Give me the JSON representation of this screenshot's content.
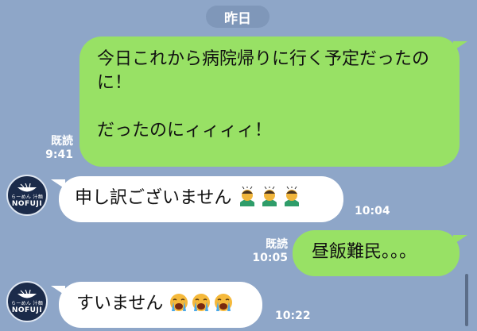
{
  "date_separator": "昨日",
  "messages": [
    {
      "side": "out",
      "text": "今日これから病院帰りに行く予定だったのに！\n\nだったのにィィィィ！",
      "read_label": "既読",
      "time": "9:41"
    },
    {
      "side": "in",
      "text": "申し訳ございません",
      "emoji": [
        "person-bowing",
        "person-bowing",
        "person-bowing"
      ],
      "time": "10:04"
    },
    {
      "side": "out",
      "text": "昼飯難民。。。",
      "read_label": "既読",
      "time": "10:05"
    },
    {
      "side": "in",
      "text": "すいません",
      "emoji": [
        "loudly-crying-face",
        "loudly-crying-face",
        "loudly-crying-face"
      ],
      "time": "10:22"
    }
  ],
  "avatar": {
    "brand": "NOFUJI",
    "subtitle": "らーめん 汁麺"
  },
  "colors": {
    "background": "#8ea6c8",
    "outgoing_bubble": "#98e165",
    "incoming_bubble": "#ffffff",
    "date_pill": "#7f97b9"
  }
}
